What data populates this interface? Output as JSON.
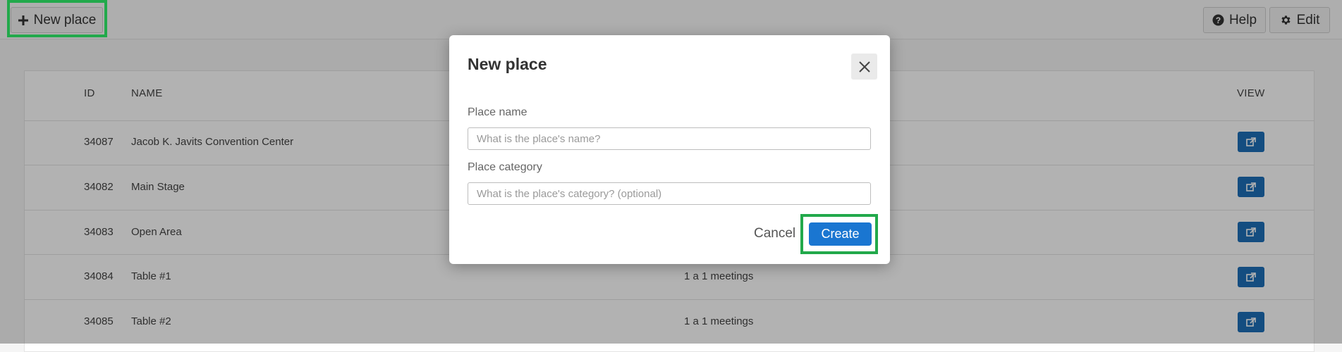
{
  "toolbar": {
    "new_place_label": "New place",
    "help_label": "Help",
    "edit_label": "Edit"
  },
  "table": {
    "headers": {
      "id": "ID",
      "name": "NAME",
      "view": "VIEW"
    },
    "rows": [
      {
        "id": "34087",
        "name": "Jacob K. Javits Convention Center",
        "category": ""
      },
      {
        "id": "34082",
        "name": "Main Stage",
        "category": ""
      },
      {
        "id": "34083",
        "name": "Open Area",
        "category": ""
      },
      {
        "id": "34084",
        "name": "Table #1",
        "category": "1 a 1 meetings"
      },
      {
        "id": "34085",
        "name": "Table #2",
        "category": "1 a 1 meetings"
      }
    ]
  },
  "modal": {
    "title": "New place",
    "place_name_label": "Place name",
    "place_name_placeholder": "What is the place's name?",
    "place_category_label": "Place category",
    "place_category_placeholder": "What is the place's category? (optional)",
    "cancel_label": "Cancel",
    "create_label": "Create"
  },
  "colors": {
    "primary": "#1a76d1",
    "view_button": "#1e6fb8",
    "highlight": "#22a94b"
  },
  "icons": {
    "new": "plus-icon",
    "help": "question-circle-icon",
    "edit": "gear-icon",
    "view": "external-link-icon",
    "close": "close-icon"
  }
}
